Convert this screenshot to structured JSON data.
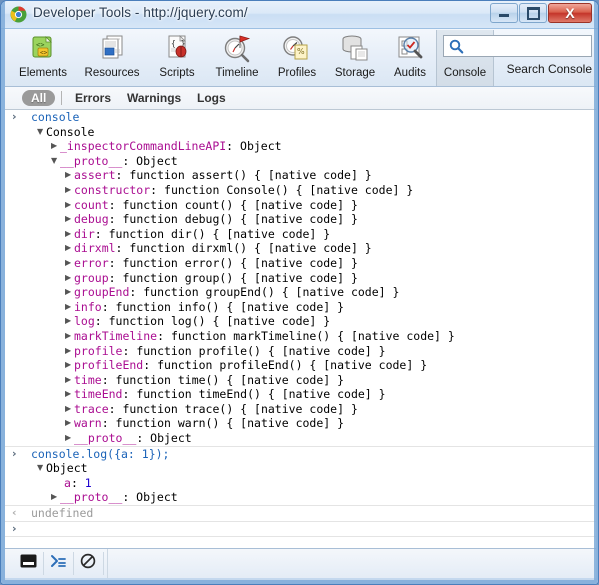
{
  "window": {
    "title": "Developer Tools - http://jquery.com/",
    "icon": "chrome-logo-icon",
    "buttons": {
      "minimize": "minimize-icon",
      "maximize": "maximize-icon",
      "close": "X"
    }
  },
  "toolbar": {
    "items": [
      {
        "label": "Elements",
        "icon": "elements-icon",
        "selected": false
      },
      {
        "label": "Resources",
        "icon": "resources-icon",
        "selected": false
      },
      {
        "label": "Scripts",
        "icon": "scripts-icon",
        "selected": false
      },
      {
        "label": "Timeline",
        "icon": "timeline-icon",
        "selected": false
      },
      {
        "label": "Profiles",
        "icon": "profiles-icon",
        "selected": false
      },
      {
        "label": "Storage",
        "icon": "storage-icon",
        "selected": false
      },
      {
        "label": "Audits",
        "icon": "audits-icon",
        "selected": false
      },
      {
        "label": "Console",
        "icon": "console-icon",
        "selected": true
      }
    ],
    "search": {
      "value": "",
      "placeholder": "",
      "label": "Search Console",
      "icon": "search-icon"
    }
  },
  "filterbar": {
    "items": [
      {
        "label": "All",
        "active": true
      },
      {
        "label": "Errors",
        "active": false
      },
      {
        "label": "Warnings",
        "active": false
      },
      {
        "label": "Logs",
        "active": false
      }
    ]
  },
  "console": {
    "groups": [
      {
        "lines": [
          {
            "kind": "cmd",
            "caret": "›",
            "indent": 26,
            "text": "console"
          },
          {
            "kind": "node",
            "tri": "▼",
            "triX": 32,
            "indent": 41,
            "text": "Console"
          },
          {
            "kind": "node",
            "tri": "▶",
            "triX": 46,
            "indent": 55,
            "prop": "_inspectorCommandLineAPI",
            "value": ": Object"
          },
          {
            "kind": "node",
            "tri": "▼",
            "triX": 46,
            "indent": 55,
            "prop": "__proto__",
            "value": ": Object"
          },
          {
            "kind": "node",
            "tri": "▶",
            "triX": 60,
            "indent": 69,
            "prop": "assert",
            "value": ": function assert() { [native code] }"
          },
          {
            "kind": "node",
            "tri": "▶",
            "triX": 60,
            "indent": 69,
            "prop": "constructor",
            "value": ": function Console() { [native code] }"
          },
          {
            "kind": "node",
            "tri": "▶",
            "triX": 60,
            "indent": 69,
            "prop": "count",
            "value": ": function count() { [native code] }"
          },
          {
            "kind": "node",
            "tri": "▶",
            "triX": 60,
            "indent": 69,
            "prop": "debug",
            "value": ": function debug() { [native code] }"
          },
          {
            "kind": "node",
            "tri": "▶",
            "triX": 60,
            "indent": 69,
            "prop": "dir",
            "value": ": function dir() { [native code] }"
          },
          {
            "kind": "node",
            "tri": "▶",
            "triX": 60,
            "indent": 69,
            "prop": "dirxml",
            "value": ": function dirxml() { [native code] }"
          },
          {
            "kind": "node",
            "tri": "▶",
            "triX": 60,
            "indent": 69,
            "prop": "error",
            "value": ": function error() { [native code] }"
          },
          {
            "kind": "node",
            "tri": "▶",
            "triX": 60,
            "indent": 69,
            "prop": "group",
            "value": ": function group() { [native code] }"
          },
          {
            "kind": "node",
            "tri": "▶",
            "triX": 60,
            "indent": 69,
            "prop": "groupEnd",
            "value": ": function groupEnd() { [native code] }"
          },
          {
            "kind": "node",
            "tri": "▶",
            "triX": 60,
            "indent": 69,
            "prop": "info",
            "value": ": function info() { [native code] }"
          },
          {
            "kind": "node",
            "tri": "▶",
            "triX": 60,
            "indent": 69,
            "prop": "log",
            "value": ": function log() { [native code] }"
          },
          {
            "kind": "node",
            "tri": "▶",
            "triX": 60,
            "indent": 69,
            "prop": "markTimeline",
            "value": ": function markTimeline() { [native code] }"
          },
          {
            "kind": "node",
            "tri": "▶",
            "triX": 60,
            "indent": 69,
            "prop": "profile",
            "value": ": function profile() { [native code] }"
          },
          {
            "kind": "node",
            "tri": "▶",
            "triX": 60,
            "indent": 69,
            "prop": "profileEnd",
            "value": ": function profileEnd() { [native code] }"
          },
          {
            "kind": "node",
            "tri": "▶",
            "triX": 60,
            "indent": 69,
            "prop": "time",
            "value": ": function time() { [native code] }"
          },
          {
            "kind": "node",
            "tri": "▶",
            "triX": 60,
            "indent": 69,
            "prop": "timeEnd",
            "value": ": function timeEnd() { [native code] }"
          },
          {
            "kind": "node",
            "tri": "▶",
            "triX": 60,
            "indent": 69,
            "prop": "trace",
            "value": ": function trace() { [native code] }"
          },
          {
            "kind": "node",
            "tri": "▶",
            "triX": 60,
            "indent": 69,
            "prop": "warn",
            "value": ": function warn() { [native code] }"
          },
          {
            "kind": "node",
            "tri": "▶",
            "triX": 60,
            "indent": 69,
            "prop": "__proto__",
            "value": ": Object"
          }
        ]
      },
      {
        "lines": [
          {
            "kind": "cmd",
            "caret": "›",
            "indent": 26,
            "text": "console.log({a: 1});"
          },
          {
            "kind": "node",
            "tri": "▼",
            "triX": 32,
            "indent": 41,
            "text": "Object"
          },
          {
            "kind": "node",
            "tri": "",
            "triX": 0,
            "indent": 59,
            "prop": "a",
            "value": ": ",
            "num": "1"
          },
          {
            "kind": "node",
            "tri": "▶",
            "triX": 46,
            "indent": 55,
            "prop": "__proto__",
            "value": ": Object"
          }
        ]
      },
      {
        "lines": [
          {
            "kind": "undef",
            "caret": "‹",
            "indent": 26,
            "text": "undefined"
          }
        ]
      },
      {
        "lines": [
          {
            "kind": "cmd",
            "caret": "›",
            "indent": 26,
            "text": ""
          }
        ]
      }
    ]
  },
  "statusbar": {
    "buttons": [
      {
        "icon": "console-drawer-icon",
        "name": "toggle-drawer-button"
      },
      {
        "icon": "prompt-icon",
        "name": "show-console-button"
      },
      {
        "icon": "clear-icon",
        "name": "clear-console-button"
      }
    ]
  },
  "colors": {
    "property": "#aa0d91",
    "command": "#1b63b8",
    "number": "#1c00cf",
    "muted": "#9b9b9b",
    "accent_frame": "#4a7ebb"
  }
}
